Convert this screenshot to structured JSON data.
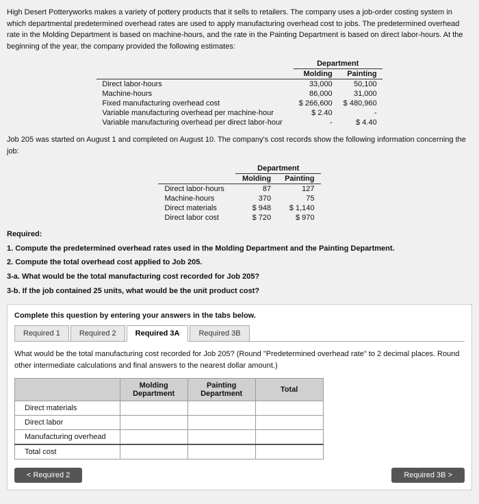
{
  "intro": {
    "text": "High Desert Potteryworks makes a variety of pottery products that it sells to retailers. The company uses a job-order costing system in which departmental predetermined overhead rates are used to apply manufacturing overhead cost to jobs. The predetermined overhead rate in the Molding Department is based on machine-hours, and the rate in the Painting Department is based on direct labor-hours. At the beginning of the year, the company provided the following estimates:"
  },
  "estimates_table": {
    "col_dept": "Department",
    "col_molding": "Molding",
    "col_painting": "Painting",
    "rows": [
      {
        "label": "Direct labor-hours",
        "molding": "33,000",
        "painting": "50,100"
      },
      {
        "label": "Machine-hours",
        "molding": "86,000",
        "painting": "31,000"
      },
      {
        "label": "Fixed manufacturing overhead cost",
        "molding": "$ 266,600",
        "painting": "$ 480,960"
      },
      {
        "label": "Variable manufacturing overhead per machine-hour",
        "molding": "$ 2.40",
        "painting": "-"
      },
      {
        "label": "Variable manufacturing overhead per direct labor-hour",
        "molding": "-",
        "painting": "$ 4.40"
      }
    ]
  },
  "job_section": {
    "intro": "Job 205 was started on August 1 and completed on August 10. The company's cost records show the following information concerning the job:",
    "col_dept": "Department",
    "col_molding": "Molding",
    "col_painting": "Painting",
    "rows": [
      {
        "label": "Direct labor-hours",
        "molding": "87",
        "painting": "127"
      },
      {
        "label": "Machine-hours",
        "molding": "370",
        "painting": "75"
      },
      {
        "label": "Direct materials",
        "molding": "$ 948",
        "painting": "$ 1,140"
      },
      {
        "label": "Direct labor cost",
        "molding": "$ 720",
        "painting": "$ 970"
      }
    ]
  },
  "required_section": {
    "title": "Required:",
    "items": [
      "1. Compute the predetermined overhead rates used in the Molding Department and the Painting Department.",
      "2. Compute the total overhead cost applied to Job 205.",
      "3-a. What would be the total manufacturing cost recorded for Job 205?",
      "3-b. If the job contained 25 units, what would be the unit product cost?"
    ]
  },
  "complete_box": {
    "title": "Complete this question by entering your answers in the tabs below.",
    "tabs": [
      {
        "label": "Required 1",
        "active": false
      },
      {
        "label": "Required 2",
        "active": false
      },
      {
        "label": "Required 3A",
        "active": true
      },
      {
        "label": "Required 3B",
        "active": false
      }
    ],
    "question": "What would be the total manufacturing cost recorded for Job 205? (Round \"Predetermined overhead rate\" to 2 decimal places. Round other intermediate calculations and final answers to the nearest dollar amount.)",
    "table": {
      "headers": [
        "",
        "Molding\nDepartment",
        "Painting\nDepartment",
        "Total"
      ],
      "rows": [
        {
          "label": "Direct materials",
          "molding": "",
          "painting": "",
          "total": ""
        },
        {
          "label": "Direct labor",
          "molding": "",
          "painting": "",
          "total": ""
        },
        {
          "label": "Manufacturing overhead",
          "molding": "",
          "painting": "",
          "total": ""
        },
        {
          "label": "Total cost",
          "molding": "",
          "painting": "",
          "total": ""
        }
      ]
    },
    "nav": {
      "back_label": "< Required 2",
      "next_label": "Required 3B >"
    }
  }
}
